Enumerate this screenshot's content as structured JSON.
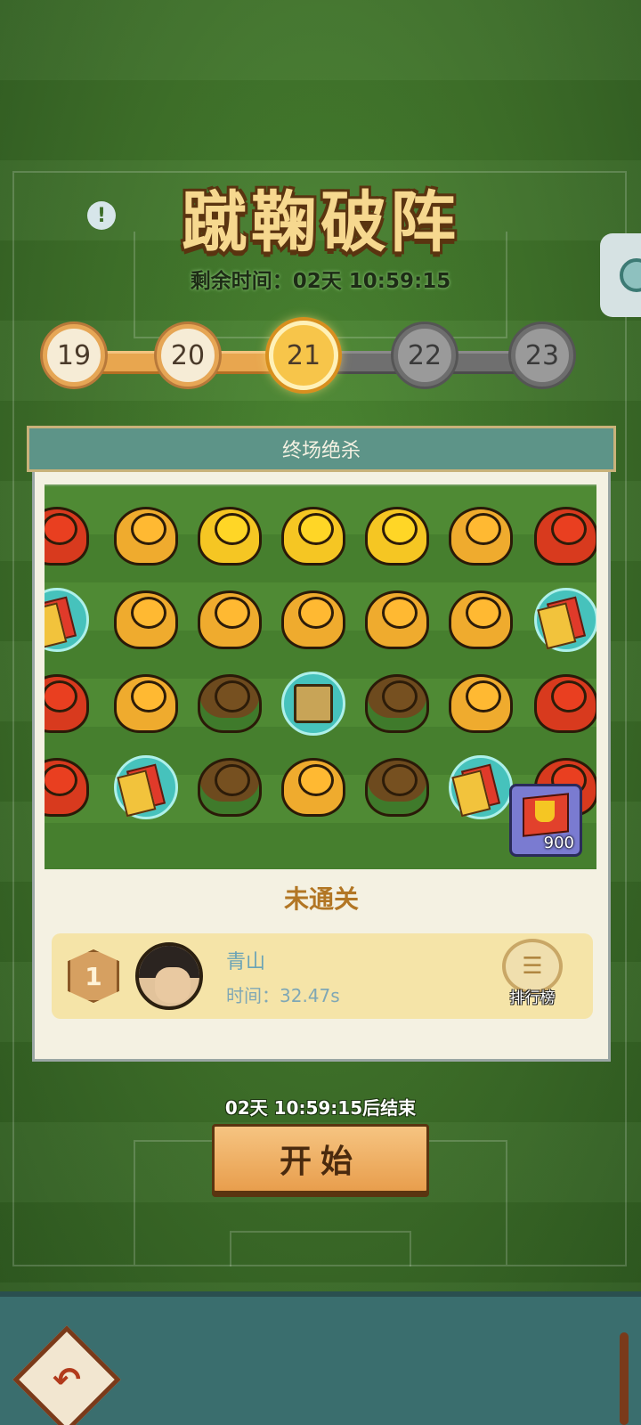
{
  "header": {
    "title": "蹴鞠破阵",
    "timer_label": "剩余时间：",
    "timer_value": "02天 10:59:15"
  },
  "levels": [
    {
      "number": "19",
      "state": "passed"
    },
    {
      "number": "20",
      "state": "passed"
    },
    {
      "number": "21",
      "state": "current"
    },
    {
      "number": "22",
      "state": "locked"
    },
    {
      "number": "23",
      "state": "locked"
    }
  ],
  "panel": {
    "level_name": "终场绝杀",
    "status": "未通关",
    "reward_value": "900",
    "leaderboard": {
      "rank": "1",
      "player_name": "青山",
      "time_label": "时间：",
      "time_value": "32.47s",
      "button_label": "排行榜"
    }
  },
  "board": {
    "rows": [
      [
        "red",
        "orange",
        "yellow",
        "yellow",
        "yellow",
        "orange",
        "red"
      ],
      [
        "card",
        "orange",
        "orange",
        "orange",
        "orange",
        "orange",
        "card"
      ],
      [
        "red",
        "orange",
        "brown",
        "spring",
        "brown",
        "orange",
        "red"
      ],
      [
        "red",
        "card",
        "brown",
        "orange",
        "brown",
        "card",
        "red"
      ]
    ]
  },
  "footer": {
    "end_text": "02天 10:59:15后结束",
    "start_label": "开始"
  },
  "icons": {
    "info": "info-icon",
    "back": "back-arrow-icon",
    "leaderboard": "scroll-icon",
    "reward": "trophy-flag-icon"
  },
  "colors": {
    "accent": "#e89e4d",
    "panel_header": "#5d9488",
    "status": "#b27624"
  }
}
